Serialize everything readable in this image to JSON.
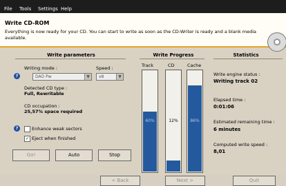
{
  "menu": [
    "File",
    "Tools",
    "Settings",
    "Help"
  ],
  "header": {
    "title": "Write CD-ROM",
    "description": "Everything is now ready for your CD. You can start to write as soon as the CD-Writer is ready and a blank media available."
  },
  "write_parameters": {
    "title": "Write parameters",
    "writing_mode_label": "Writing mode :",
    "writing_mode_value": "DAO Pw",
    "speed_label": "Speed :",
    "speed_value": "x8",
    "detected_type_label": "Detected CD type :",
    "detected_type_value": "Full, Rewritable",
    "occupation_label": "CD occupation :",
    "occupation_value": "25,57% space required",
    "enhance_label": "Enhance weak sectors",
    "enhance_checked": false,
    "eject_label": "Eject when finished",
    "eject_checked": true,
    "buttons": [
      "Go!",
      "Auto",
      "Stop"
    ]
  },
  "write_progress": {
    "title": "Write Progress",
    "bars": [
      {
        "label": "Track",
        "value": 60,
        "text": "60%"
      },
      {
        "label": "CD",
        "value": 12,
        "text": "12%"
      },
      {
        "label": "Cache",
        "value": 86,
        "text": "86%"
      }
    ]
  },
  "statistics": {
    "title": "Statistics",
    "engine_label": "Write engine status :",
    "engine_value": "Writing track 02",
    "elapsed_label": "Elapsed time :",
    "elapsed_value": "0:01:06",
    "remaining_label": "Estimated remaining time :",
    "remaining_value": "6 minutes",
    "speed_label": "Computed write speed :",
    "speed_value": "8,01"
  },
  "nav": {
    "back": "< Back",
    "next": "Next >",
    "quit": "Quit"
  },
  "icons": {
    "help": "help-icon",
    "cd": "cd-icon"
  }
}
